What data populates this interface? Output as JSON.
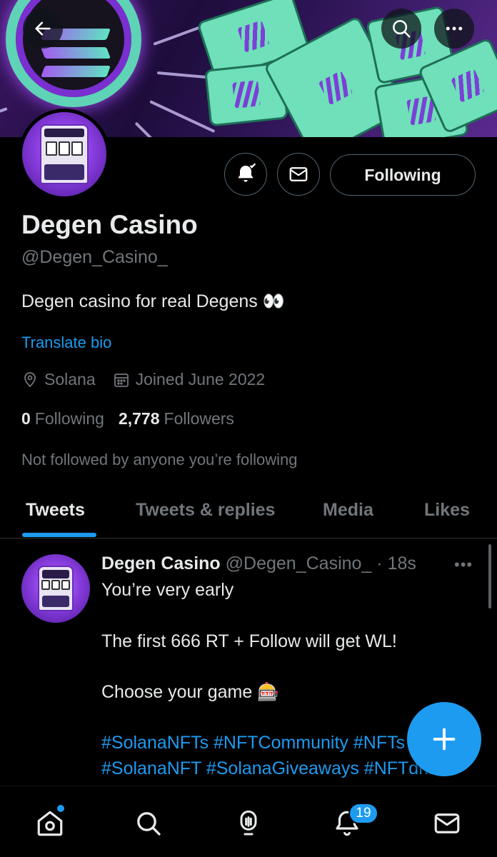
{
  "header": {
    "back_icon": "arrow-left-icon",
    "search_icon": "search-icon",
    "more_icon": "more-horizontal-icon"
  },
  "profile": {
    "name": "Degen Casino",
    "handle": "@Degen_Casino_",
    "bio": "Degen casino for real Degens 👀",
    "translate_label": "Translate bio",
    "location": "Solana",
    "joined": "Joined June 2022",
    "following_count": "0",
    "following_label": "Following",
    "followers_count": "2,778",
    "followers_label": "Followers",
    "not_followed_text": "Not followed by anyone you’re following",
    "following_button_label": "Following"
  },
  "tabs": [
    {
      "label": "Tweets",
      "active": true
    },
    {
      "label": "Tweets & replies",
      "active": false
    },
    {
      "label": "Media",
      "active": false
    },
    {
      "label": "Likes",
      "active": false
    }
  ],
  "tweet": {
    "author_name": "Degen Casino",
    "author_handle": "@Degen_Casino_",
    "time": "· 18s",
    "more": "•••",
    "line1": "You’re very early",
    "line2": "The first 666 RT + Follow will get WL!",
    "line3": "Choose your game 🎰",
    "tags1": "#SolanaNFTs #NFTCommunity #NFTs",
    "tags2": "#SolanaNFT #SolanaGiveaways #NFTdrill"
  },
  "bottom_nav": {
    "notifications_badge": "19"
  },
  "colors": {
    "accent": "#1d9bf0",
    "background": "#000000",
    "muted_text": "#71767b"
  }
}
